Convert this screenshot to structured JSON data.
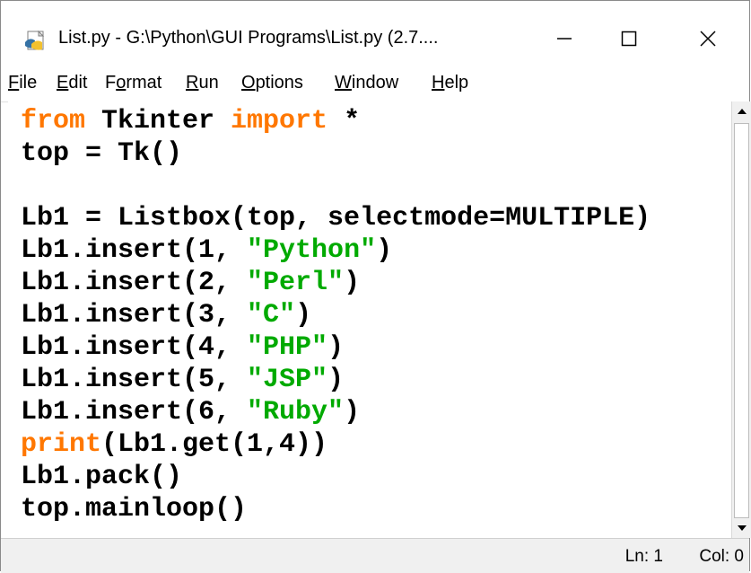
{
  "window": {
    "title": "List.py - G:\\Python\\GUI Programs\\List.py (2.7....",
    "icon": "python-file-icon"
  },
  "titlebar_buttons": {
    "minimize": "minimize-icon",
    "maximize": "maximize-icon",
    "close": "close-icon"
  },
  "menu": [
    {
      "label": "File",
      "mnemonic": "F",
      "rest": "ile"
    },
    {
      "label": "Edit",
      "mnemonic": "E",
      "rest": "dit"
    },
    {
      "label": "Format",
      "pre": "F",
      "mnemonic": "o",
      "rest": "rmat"
    },
    {
      "label": "Run",
      "mnemonic": "R",
      "rest": "un"
    },
    {
      "label": "Options",
      "mnemonic": "O",
      "rest": "ptions"
    },
    {
      "label": "Window",
      "mnemonic": "W",
      "rest": "indow"
    },
    {
      "label": "Help",
      "mnemonic": "H",
      "rest": "elp"
    }
  ],
  "code": {
    "line1": {
      "kw1": "from",
      "mid": " Tkinter ",
      "kw2": "import",
      "end": " *"
    },
    "line2": "top = Tk()",
    "line3": "",
    "line4": "Lb1 = Listbox(top, selectmode=MULTIPLE)",
    "line5": {
      "pre": "Lb1.insert(1, ",
      "str": "\"Python\"",
      "post": ")"
    },
    "line6": {
      "pre": "Lb1.insert(2, ",
      "str": "\"Perl\"",
      "post": ")"
    },
    "line7": {
      "pre": "Lb1.insert(3, ",
      "str": "\"C\"",
      "post": ")"
    },
    "line8": {
      "pre": "Lb1.insert(4, ",
      "str": "\"PHP\"",
      "post": ")"
    },
    "line9": {
      "pre": "Lb1.insert(5, ",
      "str": "\"JSP\"",
      "post": ")"
    },
    "line10": {
      "pre": "Lb1.insert(6, ",
      "str": "\"Ruby\"",
      "post": ")"
    },
    "line11": {
      "kw": "print",
      "rest": "(Lb1.get(1,4))"
    },
    "line12": "Lb1.pack()",
    "line13": "top.mainloop()"
  },
  "status": {
    "line": "Ln: 1",
    "col": "Col: 0"
  },
  "colors": {
    "keyword": "#ff7700",
    "string": "#00aa00",
    "text": "#000000"
  }
}
